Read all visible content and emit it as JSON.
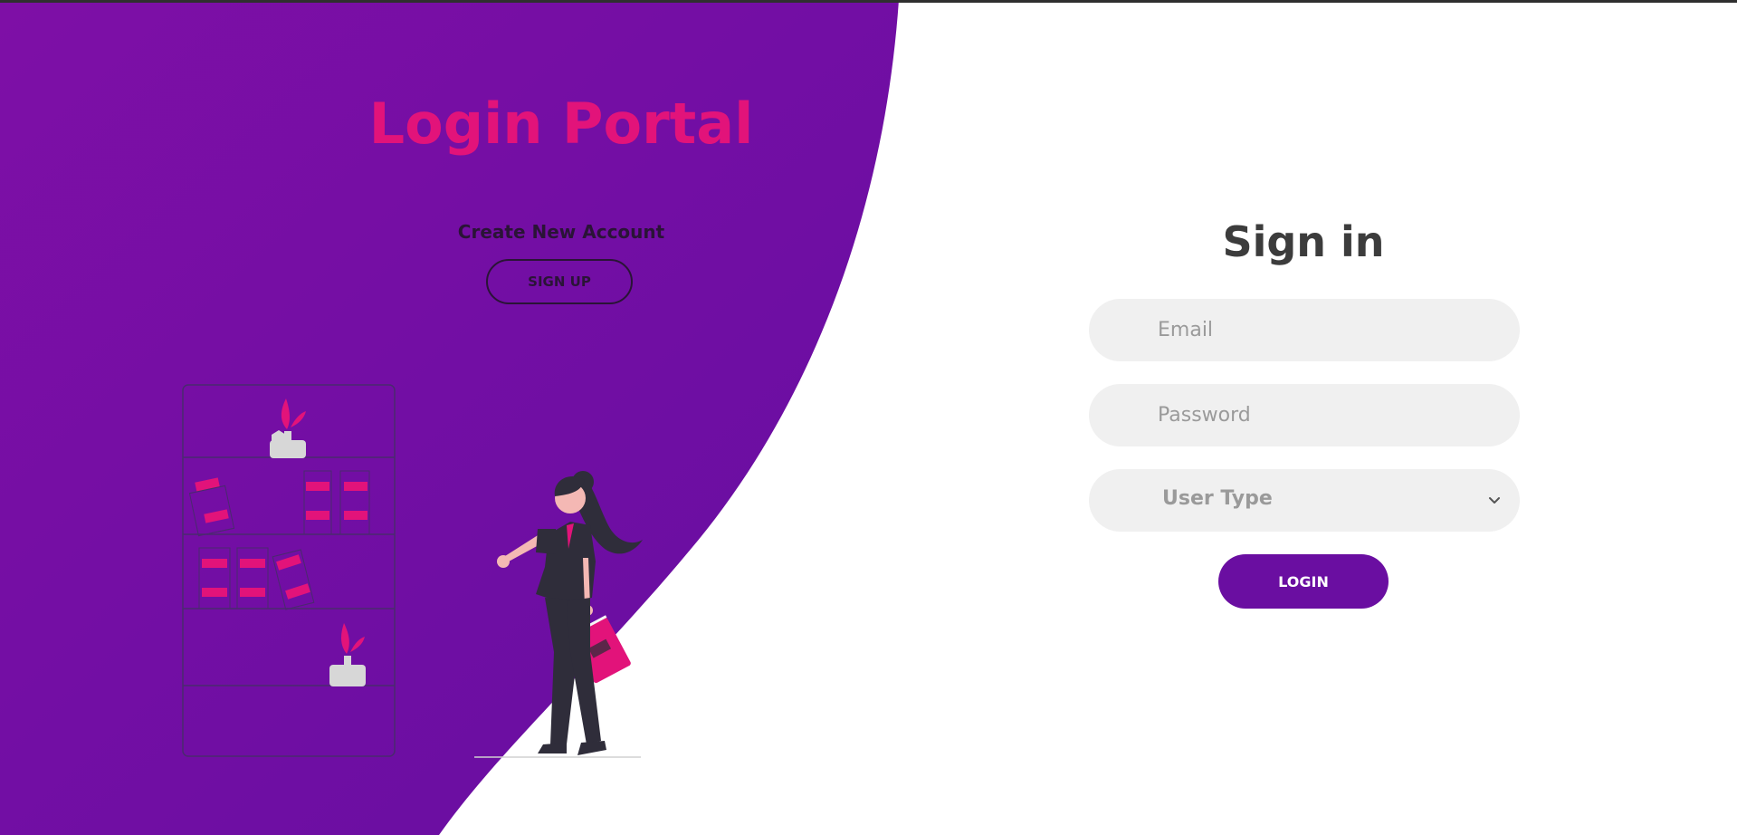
{
  "left_panel": {
    "title": "Login Portal",
    "create_account_text": "Create New Account",
    "signup_label": "SIGN UP"
  },
  "form": {
    "title": "Sign in",
    "email_placeholder": "Email",
    "password_placeholder": "Password",
    "user_type_value": "User Type",
    "login_label": "LOGIN"
  },
  "colors": {
    "purple_gradient_start": "#7e0fa6",
    "purple_gradient_end": "#6a0ea1",
    "accent_pink": "#e2137a",
    "button_purple": "#6a0ea1",
    "field_gray": "#f0f0f0"
  },
  "icons": {
    "user_type_dropdown": "chevron-down-icon"
  }
}
